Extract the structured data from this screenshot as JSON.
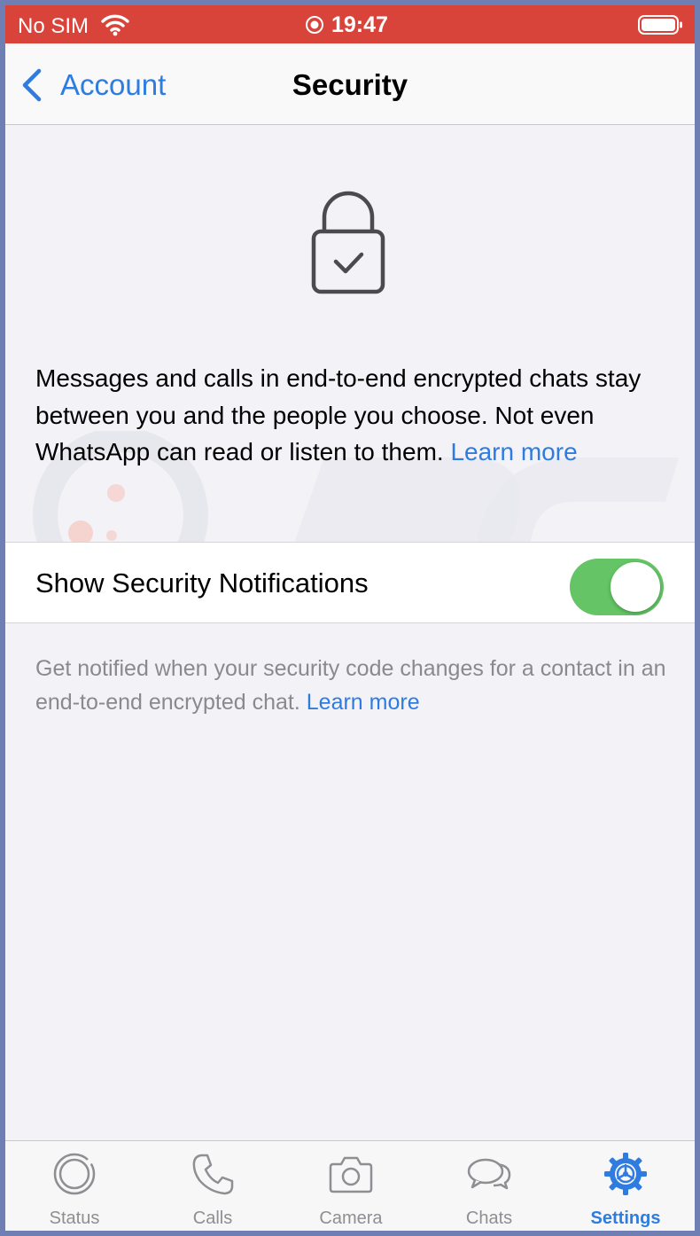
{
  "status_bar": {
    "carrier": "No SIM",
    "time": "19:47",
    "background_color": "#d9443a"
  },
  "nav": {
    "back_label": "Account",
    "title": "Security"
  },
  "intro": {
    "text": "Messages and calls in end-to-end encrypted chats stay between you and the people you choose. Not even WhatsApp can read or listen to them.",
    "link": "Learn more"
  },
  "settings": {
    "show_notifications_label": "Show Security Notifications",
    "show_notifications_enabled": true,
    "footnote": "Get notified when your security code changes for a contact in an end-to-end encrypted chat.",
    "footnote_link": "Learn more"
  },
  "tabs": [
    {
      "label": "Status",
      "icon": "status-icon"
    },
    {
      "label": "Calls",
      "icon": "phone-icon"
    },
    {
      "label": "Camera",
      "icon": "camera-icon"
    },
    {
      "label": "Chats",
      "icon": "chat-bubbles-icon"
    },
    {
      "label": "Settings",
      "icon": "gear-icon",
      "active": true
    }
  ],
  "colors": {
    "accent": "#2f7ce0",
    "toggle_on": "#64c466",
    "background": "#f2f2f7"
  }
}
